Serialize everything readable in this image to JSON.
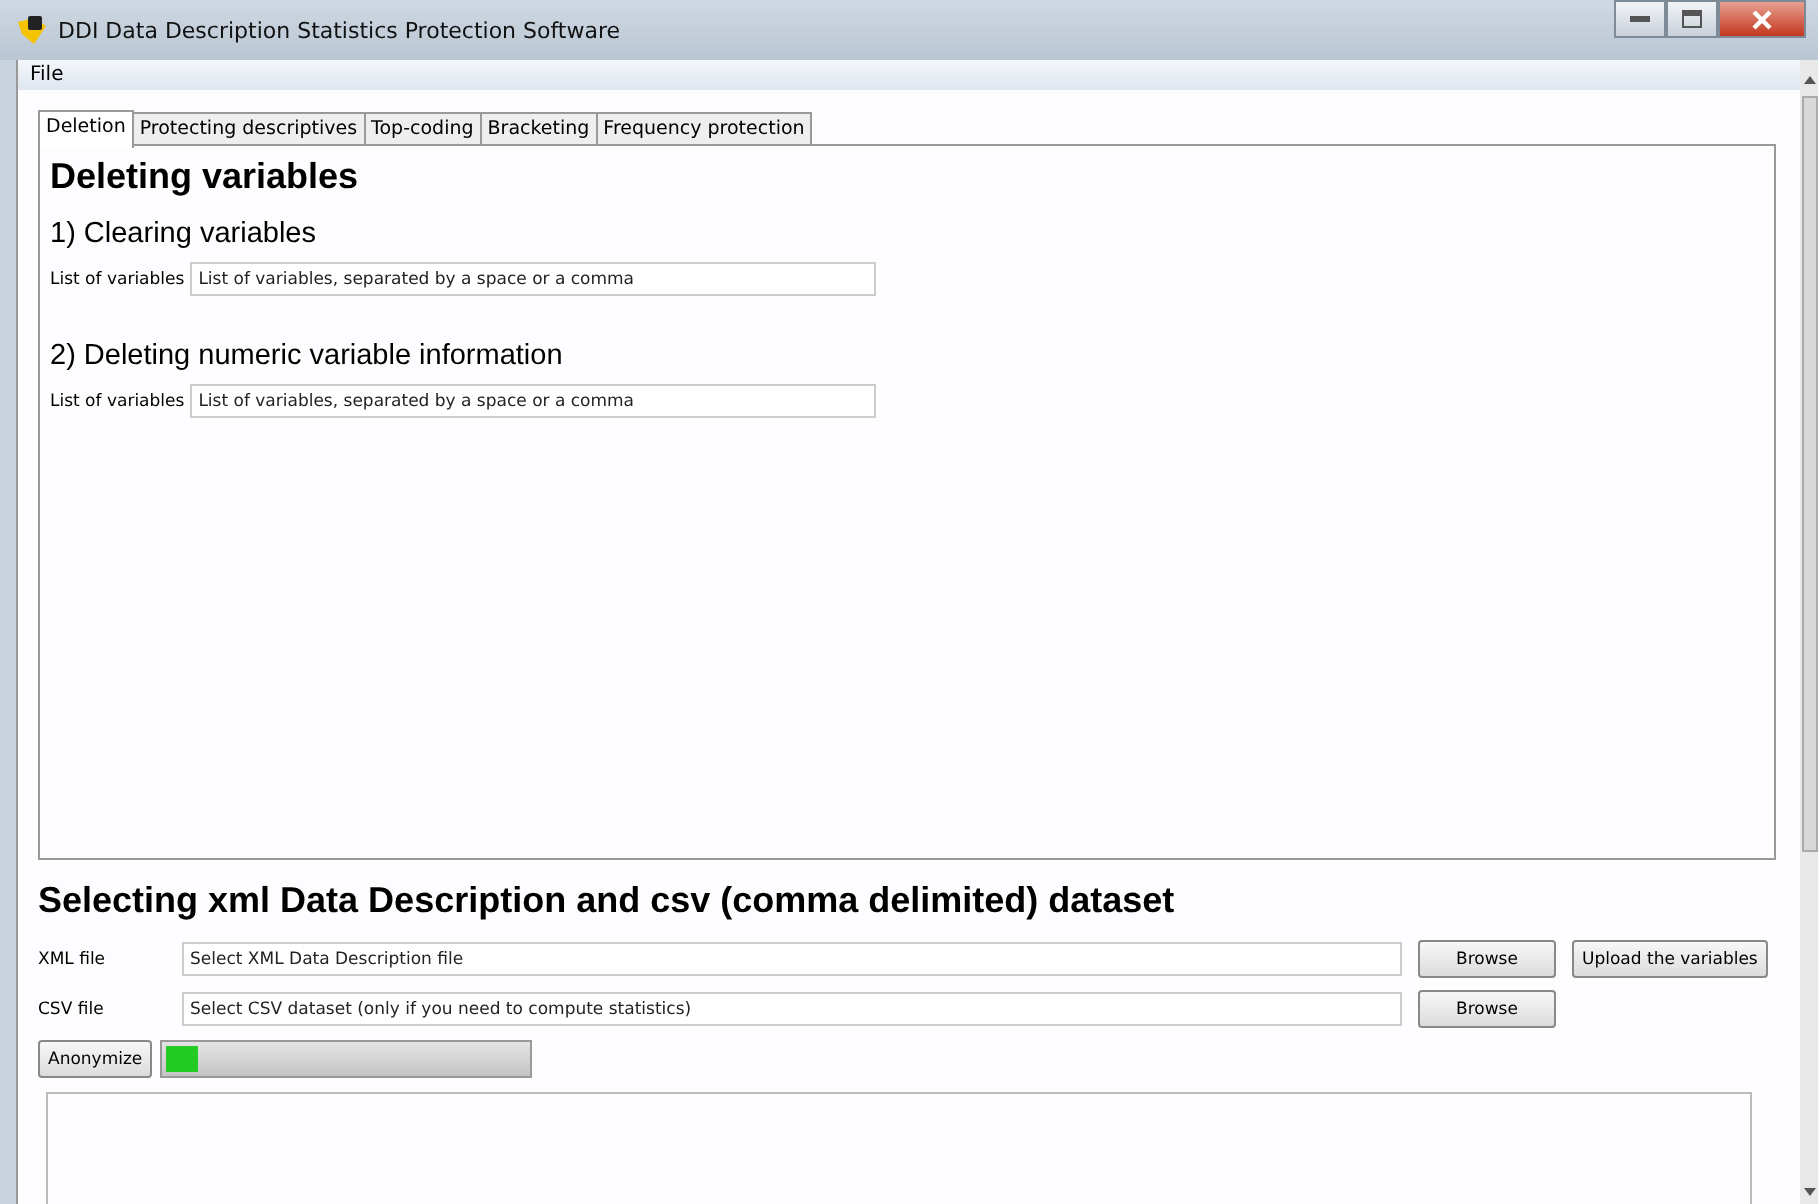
{
  "window": {
    "title": "DDI Data Description Statistics Protection Software"
  },
  "menu": [
    "File"
  ],
  "tabs": [
    {
      "label": "Deletion",
      "selected": true
    },
    {
      "label": "Protecting descriptives",
      "selected": false
    },
    {
      "label": "Top-coding",
      "selected": false
    },
    {
      "label": "Bracketing",
      "selected": false
    },
    {
      "label": "Frequency protection",
      "selected": false
    }
  ],
  "panel": {
    "heading": "Deleting variables",
    "sections": [
      {
        "title": "1) Clearing variables",
        "label": "List of variables",
        "value": "List of variables, separated by a space or a comma"
      },
      {
        "title": "2) Deleting numeric variable information",
        "label": "List of variables",
        "value": "List of variables, separated by a space or a comma"
      }
    ]
  },
  "files": {
    "heading": "Selecting xml Data Description and csv (comma delimited) dataset",
    "rows": [
      {
        "label": "XML file",
        "value": "Select XML Data Description file",
        "buttons": [
          "Browse",
          "Upload the variables"
        ]
      },
      {
        "label": "CSV file",
        "value": "Select CSV dataset (only if you need to compute statistics)",
        "buttons": [
          "Browse"
        ]
      }
    ]
  },
  "anonymize": {
    "button": "Anonymize",
    "level": 0.09
  }
}
